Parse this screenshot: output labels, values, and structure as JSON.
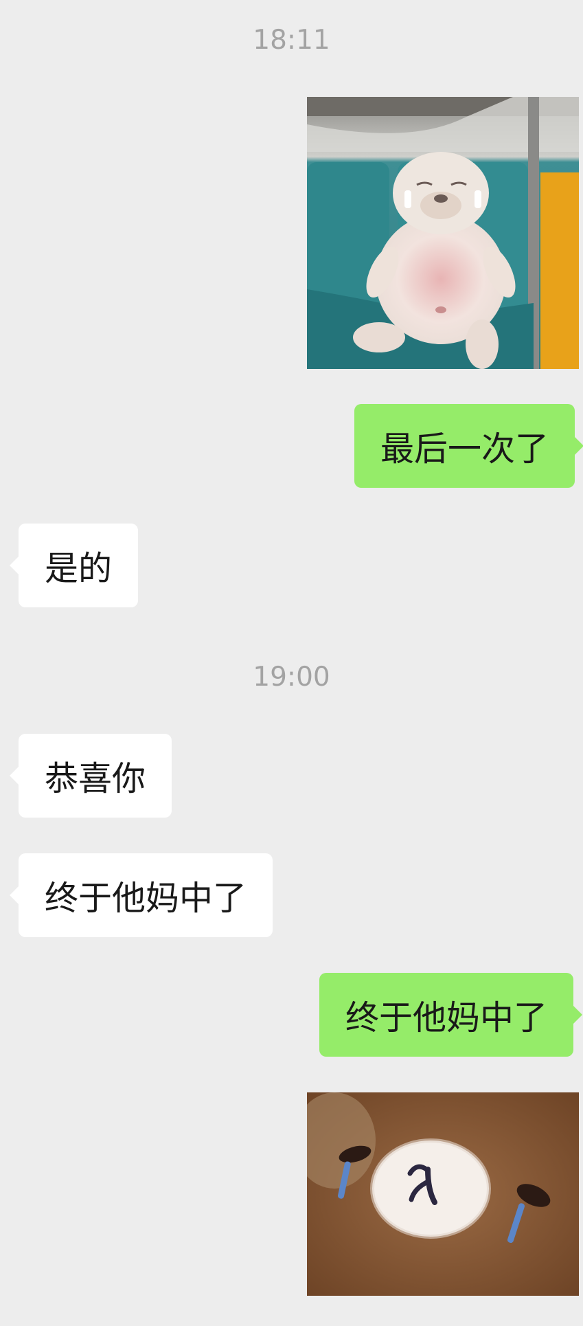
{
  "messages": {
    "timestamp_1": "18:11",
    "timestamp_2": "19:00",
    "sent_1": "最后一次了",
    "received_1": "是的",
    "received_2": "恭喜你",
    "received_3": "终于他妈中了",
    "sent_2": "终于他妈中了",
    "sticker_1": "dog-sitting-on-subway-seat-sticker",
    "sticker_2": "crying-bear-face-sticker"
  },
  "colors": {
    "background": "#EDEDED",
    "sent_bubble": "#95EC69",
    "received_bubble": "#FFFFFF",
    "timestamp_text": "#A3A3A3",
    "message_text": "#191919"
  }
}
